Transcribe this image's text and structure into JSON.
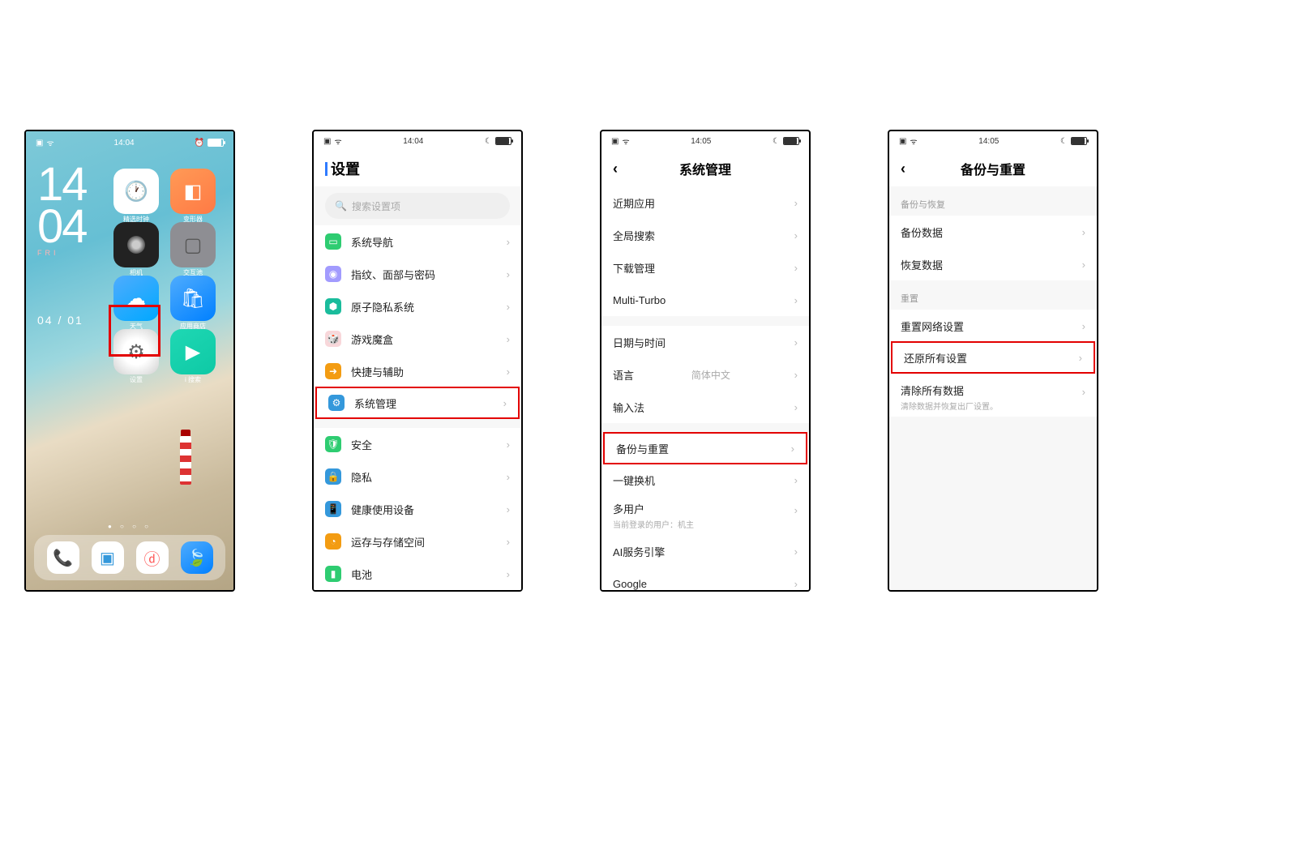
{
  "screen1": {
    "statusbar": {
      "time": "14:04",
      "battery": "94"
    },
    "clock": {
      "hh": "14",
      "mm": "04",
      "day": "FRI"
    },
    "date": "04 / 01",
    "apps": [
      {
        "name": "时钟",
        "label": "精选时钟"
      },
      {
        "name": "变形器",
        "label": "变形器"
      },
      {
        "name": "相机",
        "label": "相机"
      },
      {
        "name": "交互池",
        "label": "交互池"
      },
      {
        "name": "天气",
        "label": "天气"
      },
      {
        "name": "应用商店",
        "label": "应用商店"
      },
      {
        "name": "settings",
        "label": "设置"
      },
      {
        "name": "搜索",
        "label": "i 搜索"
      }
    ],
    "dock": [
      "phone",
      "apps",
      "music",
      "browser"
    ]
  },
  "screen2": {
    "statusbar": {
      "time": "14:04",
      "battery": "94"
    },
    "title": "设置",
    "search_placeholder": "搜索设置项",
    "group1": [
      {
        "k": "nav",
        "label": "系统导航"
      },
      {
        "k": "finger",
        "label": "指纹、面部与密码"
      },
      {
        "k": "atom",
        "label": "原子隐私系统"
      },
      {
        "k": "game",
        "label": "游戏魔盒"
      },
      {
        "k": "quick",
        "label": "快捷与辅助"
      },
      {
        "k": "sys",
        "label": "系统管理",
        "highlight": true
      }
    ],
    "group2": [
      {
        "k": "sec",
        "label": "安全"
      },
      {
        "k": "priv",
        "label": "隐私"
      },
      {
        "k": "health",
        "label": "健康使用设备"
      },
      {
        "k": "store",
        "label": "运存与存储空间"
      },
      {
        "k": "batt",
        "label": "电池"
      }
    ]
  },
  "screen3": {
    "statusbar": {
      "time": "14:05",
      "battery": "94"
    },
    "title": "系统管理",
    "group1": [
      {
        "label": "近期应用"
      },
      {
        "label": "全局搜索"
      },
      {
        "label": "下载管理"
      },
      {
        "label": "Multi-Turbo"
      }
    ],
    "group2": [
      {
        "label": "日期与时间"
      },
      {
        "label": "语言",
        "trail": "简体中文"
      },
      {
        "label": "输入法"
      }
    ],
    "group3": [
      {
        "label": "备份与重置",
        "highlight": true
      },
      {
        "label": "一键换机"
      },
      {
        "label": "多用户",
        "desc": "当前登录的用户：机主"
      },
      {
        "label": "AI服务引擎"
      },
      {
        "label": "Google"
      }
    ]
  },
  "screen4": {
    "statusbar": {
      "time": "14:05",
      "battery": "94"
    },
    "title": "备份与重置",
    "section1": {
      "label": "备份与恢复",
      "rows": [
        {
          "label": "备份数据"
        },
        {
          "label": "恢复数据"
        }
      ]
    },
    "section2": {
      "label": "重置",
      "rows": [
        {
          "label": "重置网络设置"
        },
        {
          "label": "还原所有设置",
          "highlight": true
        },
        {
          "label": "清除所有数据",
          "desc": "清除数据并恢复出厂设置。"
        }
      ]
    }
  }
}
